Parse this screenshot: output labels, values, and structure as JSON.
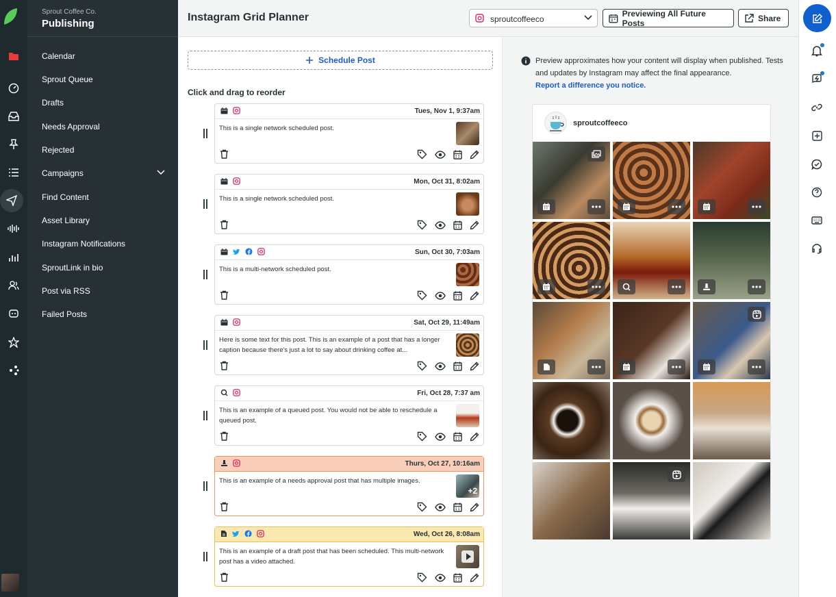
{
  "org_name": "Sprout Coffee Co.",
  "section_title": "Publishing",
  "menu_items": [
    "Calendar",
    "Sprout Queue",
    "Drafts",
    "Needs Approval",
    "Rejected",
    "Campaigns",
    "Find Content",
    "Asset Library",
    "Instagram Notifications",
    "SproutLink in bio",
    "Post via RSS",
    "Failed Posts"
  ],
  "header": {
    "title": "Instagram Grid Planner",
    "profile_value": "sproutcoffeeco",
    "preview_label": "Previewing All Future Posts",
    "share_label": "Share"
  },
  "queue": {
    "schedule_label": "Schedule Post",
    "reorder_hint": "Click and drag to reorder",
    "posts": [
      {
        "date": "Tues, Nov 1, 9:37am",
        "caption": "This is a single network scheduled post.",
        "status": "scheduled",
        "networks": [
          "instagram"
        ]
      },
      {
        "date": "Mon, Oct 31, 8:02am",
        "caption": "This is a single network scheduled post.",
        "status": "scheduled",
        "networks": [
          "instagram"
        ]
      },
      {
        "date": "Sun, Oct 30, 7:03am",
        "caption": "This is a multi-network scheduled post.",
        "status": "scheduled",
        "networks": [
          "twitter",
          "facebook",
          "instagram"
        ]
      },
      {
        "date": "Sat, Oct 29, 11:49am",
        "caption": "Here is some text for this post. This is an example of a post that has a longer caption because there's just a lot to say about drinking coffee at...",
        "status": "scheduled",
        "networks": [
          "instagram"
        ]
      },
      {
        "date": "Fri, Oct 28, 7:37 am",
        "caption": "This is an example of a queued post. You would not be able to reschedule a queued post.",
        "status": "queued",
        "networks": [
          "instagram"
        ]
      },
      {
        "date": "Thurs, Oct 27, 10:16am",
        "caption": "This is an example of a needs approval post that has multiple images.",
        "status": "approval",
        "networks": [
          "instagram"
        ],
        "extra_images": "+2"
      },
      {
        "date": "Wed, Oct 26, 8:08am",
        "caption": "This is an example of a draft post that has been scheduled. This multi-network post has a video attached.",
        "status": "draft",
        "networks": [
          "twitter",
          "facebook",
          "instagram"
        ]
      }
    ]
  },
  "preview": {
    "notice": "Preview approximates how your content will display when published. Tests and updates by Instagram may affect the final appearance.",
    "notice_link": "Report a difference you notice.",
    "ig_handle": "sproutcoffeeco"
  },
  "colors": {
    "accent": "#205bc3",
    "approval": "#f9cfba",
    "draft": "#fbe7b0",
    "sidebar": "#273135",
    "rail": "#1e2a2e"
  }
}
